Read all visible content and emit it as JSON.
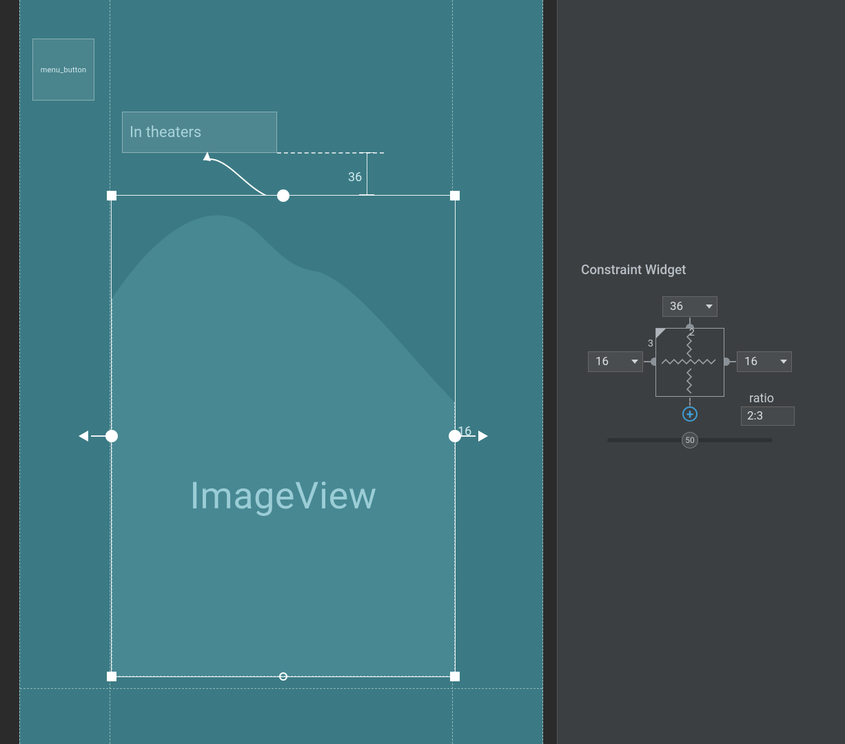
{
  "canvas": {
    "menu_button_label": "menu_button",
    "in_theaters_label": "In theaters",
    "top_margin_value": "36",
    "right_margin_value": "16",
    "image_view_label": "ImageView"
  },
  "constraint_widget": {
    "title": "Constraint Widget",
    "top_margin": "36",
    "left_margin": "16",
    "right_margin": "16",
    "ratio_width_number": "2",
    "ratio_height_number": "3",
    "ratio_label": "ratio",
    "ratio_value": "2:3",
    "horizontal_bias": "50"
  }
}
